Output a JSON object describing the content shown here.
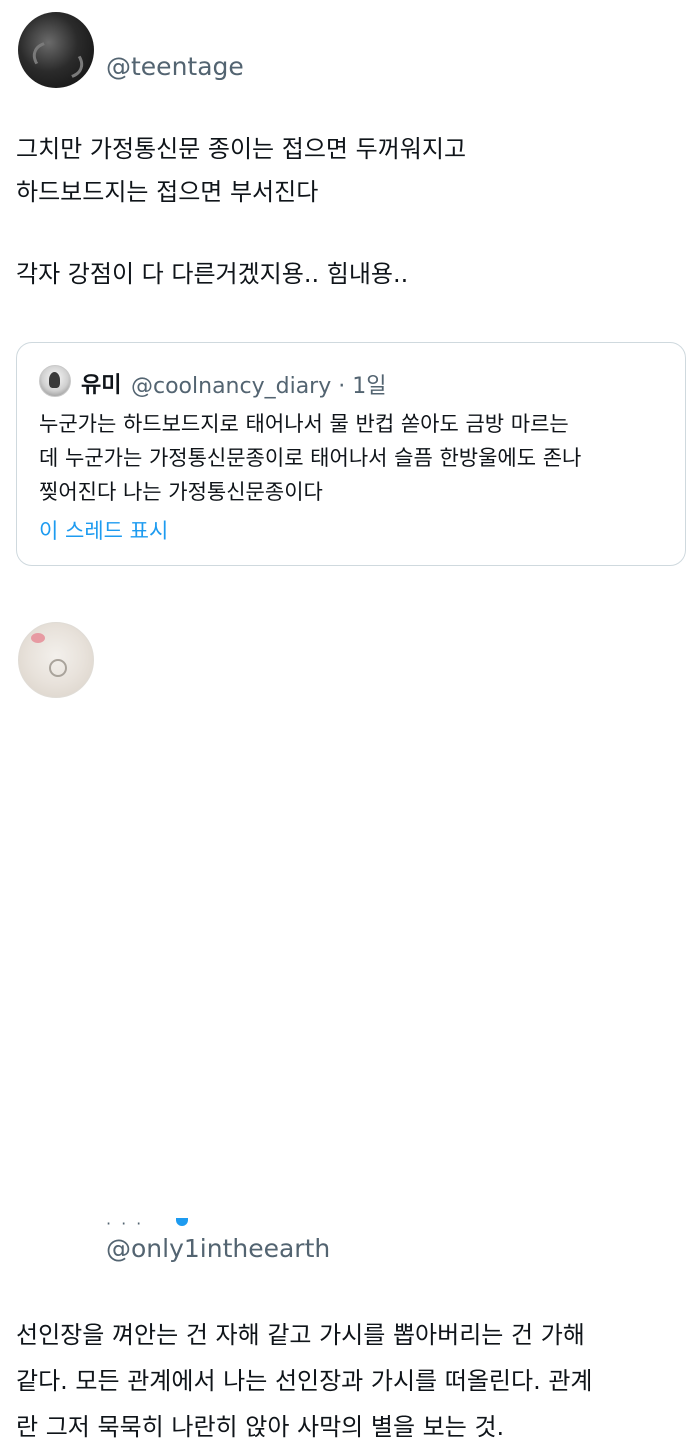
{
  "tweets": [
    {
      "handle": "@teentage",
      "body_lines": [
        "그치만 가정통신문 종이는 접으면 두꺼워지고",
        "하드보드지는 접으면 부서진다"
      ],
      "body_lines_2": [
        "각자 강점이 다 다른거겠지용.. 힘내용.."
      ],
      "quote": {
        "name": "유미",
        "handle": "@coolnancy_diary",
        "separator": "·",
        "time": "1일",
        "lines": [
          "누군가는 하드보드지로 태어나서 물 반컵 쏟아도 금방 마르는",
          "데 누군가는 가정통신문종이로 태어나서 슬픔 한방울에도 존나",
          "찢어진다 나는 가정통신문종이다"
        ],
        "show_thread": "이 스레드 표시"
      }
    },
    {
      "handle": "@only1intheearth",
      "body_lines": [
        "선인장을 껴안는 건 자해 같고 가시를 뽑아버리는 건 가해",
        "같다. 모든 관계에서 나는 선인장과 가시를 떠올린다. 관계",
        "란 그저 묵묵히 나란히 앉아 사막의 별을 보는 것."
      ]
    }
  ]
}
